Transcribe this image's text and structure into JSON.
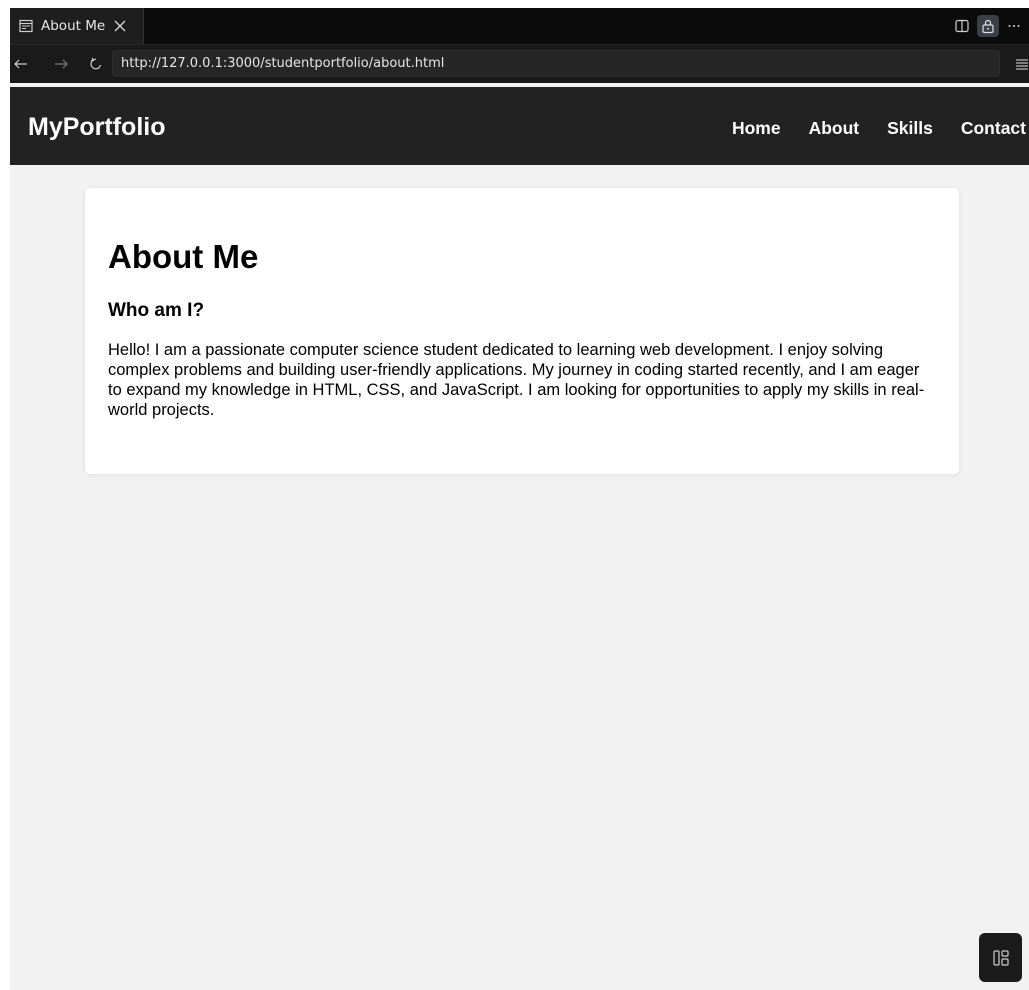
{
  "browser": {
    "tab": {
      "title": "About Me"
    },
    "url": "http://127.0.0.1:3000/studentportfolio/about.html"
  },
  "site": {
    "logo": "MyPortfolio",
    "nav": [
      "Home",
      "About",
      "Skills",
      "Contact"
    ]
  },
  "about": {
    "title": "About Me",
    "subtitle": "Who am I?",
    "paragraph": "Hello! I am a passionate computer science student dedicated to learning web development. I enjoy solving complex problems and building user-friendly applications. My journey in coding started recently, and I am eager to expand my knowledge in HTML, CSS, and JavaScript. I am looking for opportunities to apply my skills in real-world projects."
  },
  "icons": {
    "tab": "page-preview-icon",
    "close": "close-icon",
    "back": "back-arrow-icon",
    "forward": "forward-arrow-icon",
    "reload": "reload-icon",
    "split": "split-view-icon",
    "lock": "lock-icon",
    "more": "more-icon",
    "menu": "menu-icon",
    "layout": "layout-icon"
  },
  "colors": {
    "header_bg": "#222222",
    "page_bg": "#f2f2f2",
    "card_bg": "#ffffff"
  }
}
